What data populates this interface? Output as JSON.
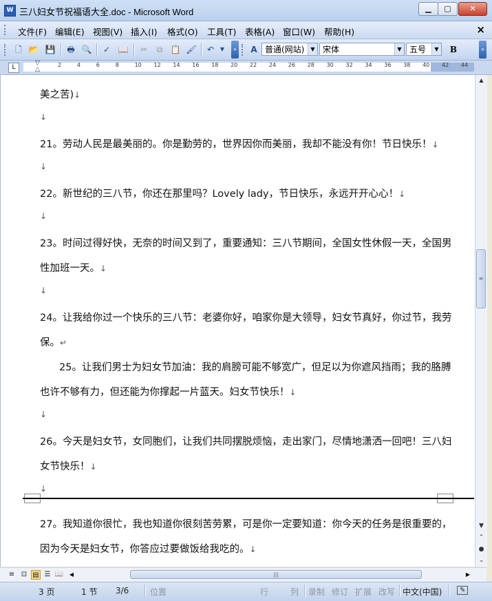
{
  "window": {
    "title": "三八妇女节祝福语大全.doc - Microsoft Word",
    "app_icon": "W"
  },
  "menu": [
    "文件(F)",
    "编辑(E)",
    "视图(V)",
    "插入(I)",
    "格式(O)",
    "工具(T)",
    "表格(A)",
    "窗口(W)",
    "帮助(H)"
  ],
  "toolbar": {
    "style": "普通(网站)",
    "font": "宋体",
    "size": "五号",
    "bold": "B",
    "style_icon": "A"
  },
  "ruler": {
    "ticks": [
      "2",
      "4",
      "6",
      "8",
      "10",
      "12",
      "14",
      "16",
      "18",
      "20",
      "22",
      "24",
      "26",
      "28",
      "30",
      "32",
      "34",
      "36",
      "38",
      "40",
      "42",
      "44"
    ]
  },
  "document": {
    "lines": [
      "美之苦)",
      "",
      "21。劳动人民是最美丽的。你是勤劳的，世界因你而美丽，我却不能没有你！节日快乐！",
      "",
      "22。新世纪的三八节，你还在那里吗？Lovely lady，节日快乐，永远开开心心！",
      "",
      "23。时间过得好快，无奈的时间又到了，重要通知：三八节期间，全国女性休假一天，全国男",
      "性加班一天。",
      "",
      "24。让我给你过一个快乐的三八节：老婆你好，咱家你是大领导，妇女节真好，你过节，我劳",
      "保。",
      "25。让我们男士为妇女节加油：我的肩膀可能不够宽广，但足以为你遮风挡雨；我的胳膊",
      "也许不够有力，但还能为你撑起一片蓝天。妇女节快乐！",
      "",
      "26。今天是妇女节，女同胞们，让我们共同摆脱烦恼，走出家门，尽情地潇洒一回吧！三八妇",
      "女节快乐！",
      "",
      "27。我知道你很忙，我也知道你很刻苦劳累，可是你一定要知道：你今天的任务是很重要的，",
      "因为今天是妇女节，你答应过要做饭给我吃的。"
    ],
    "para_mark": "↓",
    "end_mark": "↵"
  },
  "status": {
    "page": "3 页",
    "section": "1 节",
    "pages": "3/6",
    "position": "位置",
    "line": "行",
    "column": "列",
    "rec": "录制",
    "trk": "修订",
    "ext": "扩展",
    "ovr": "改写",
    "lang": "中文(中国)"
  }
}
